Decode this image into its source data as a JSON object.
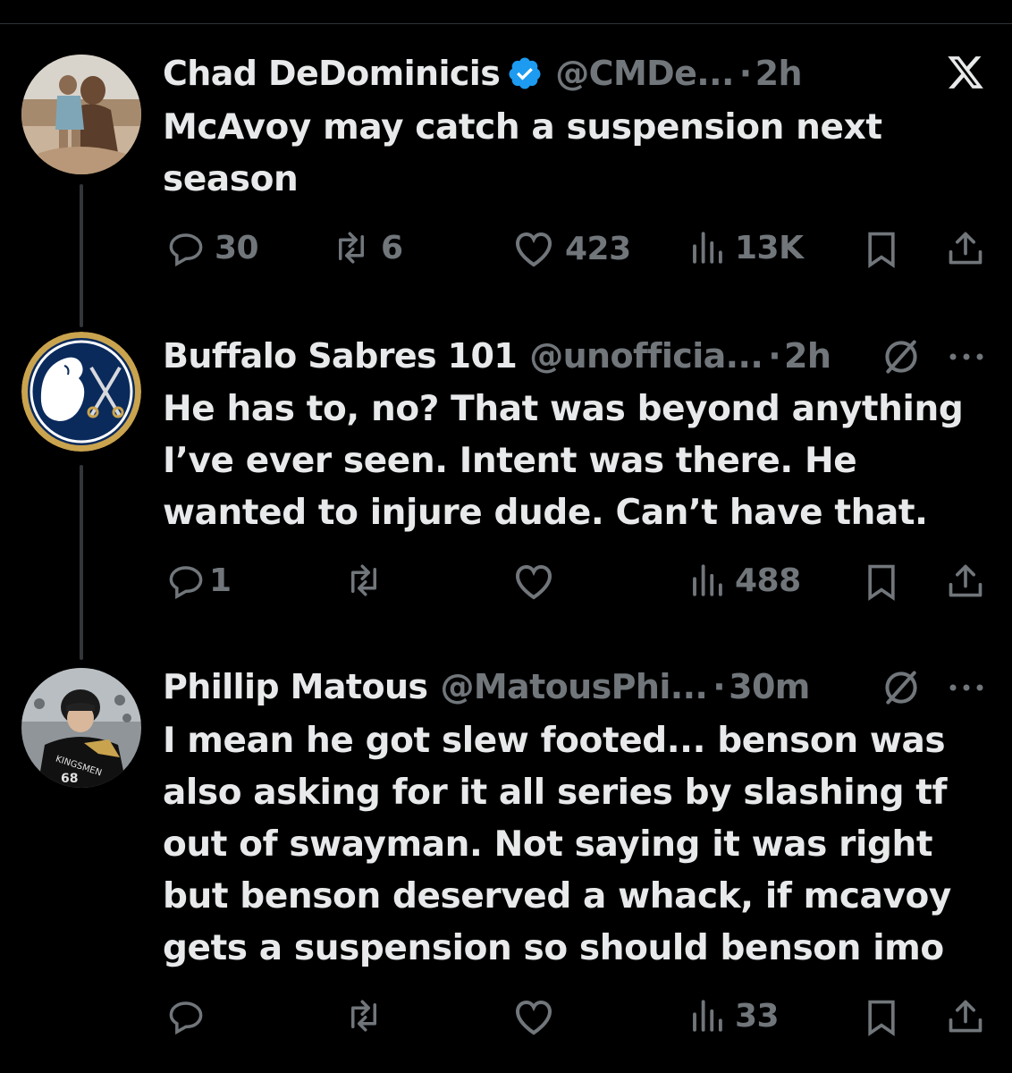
{
  "tweets": [
    {
      "name": "Chad DeDominicis",
      "handle": "@CMDe...",
      "separator": "·",
      "time": "2h",
      "verified": true,
      "text_lines": [
        "McAvoy may catch a suspension next",
        "season"
      ],
      "replies": "30",
      "retweets": "6",
      "likes": "423",
      "views": "13K"
    },
    {
      "name": "Buffalo Sabres 101",
      "handle": "@unofficia...",
      "separator": "·",
      "time": "2h",
      "verified": false,
      "text_lines": [
        "He has to, no? That was beyond anything",
        "I’ve ever seen. Intent was there. He",
        "wanted to injure dude. Can’t have that."
      ],
      "replies": "1",
      "retweets": "",
      "likes": "",
      "views": "488"
    },
    {
      "name": "Phillip Matous",
      "handle": "@MatousPhi...",
      "separator": "·",
      "time": "30m",
      "verified": false,
      "text_lines": [
        "I mean he got slew footed... benson was",
        "also asking for it all series by slashing tf",
        "out of swayman. Not saying it was right",
        "but benson deserved a whack, if mcavoy",
        "gets a suspension so should benson imo"
      ],
      "replies": "",
      "retweets": "",
      "likes": "",
      "views": "33"
    }
  ],
  "avatars": {
    "tweet1": {
      "description_icon": "avatar-photo",
      "jersey_text": ""
    },
    "tweet3": {
      "jersey_text": "KINGSMEN",
      "jersey_number": "68"
    }
  },
  "colors": {
    "background": "#000000",
    "text_primary": "#e7e9ea",
    "text_secondary": "#71767b",
    "verified_badge": "#1d9bf0",
    "thread_line": "#333639"
  },
  "icons": [
    "x-logo-icon",
    "verified-badge-icon",
    "grok-icon",
    "more-icon",
    "reply-icon",
    "retweet-icon",
    "like-icon",
    "views-icon",
    "bookmark-icon",
    "share-icon"
  ]
}
